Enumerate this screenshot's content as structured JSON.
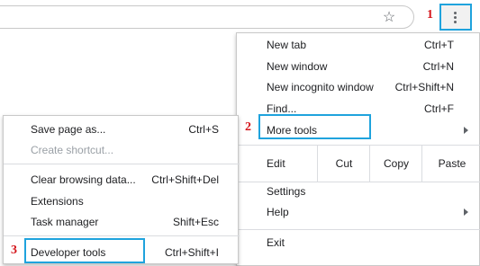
{
  "toolbar": {
    "star_icon": "star-outline-icon",
    "menu_icon": "three-dots-vertical-icon"
  },
  "steps": {
    "one": "1",
    "two": "2",
    "three": "3"
  },
  "colors": {
    "highlight": "#1fa3dd",
    "step_number": "#d4151b",
    "separator": "#dadce0"
  },
  "main_menu": {
    "new_tab": {
      "label": "New tab",
      "shortcut": "Ctrl+T"
    },
    "new_window": {
      "label": "New window",
      "shortcut": "Ctrl+N"
    },
    "new_incognito": {
      "label": "New incognito window",
      "shortcut": "Ctrl+Shift+N"
    },
    "find": {
      "label": "Find...",
      "shortcut": "Ctrl+F"
    },
    "more_tools": {
      "label": "More tools"
    },
    "edit_row": {
      "label": "Edit",
      "cut": "Cut",
      "copy": "Copy",
      "paste": "Paste"
    },
    "settings": {
      "label": "Settings"
    },
    "help": {
      "label": "Help"
    },
    "exit": {
      "label": "Exit"
    }
  },
  "sub_menu": {
    "save_page": {
      "label": "Save page as...",
      "shortcut": "Ctrl+S"
    },
    "create_shortcut": {
      "label": "Create shortcut..."
    },
    "clear_browsing": {
      "label": "Clear browsing data...",
      "shortcut": "Ctrl+Shift+Del"
    },
    "extensions": {
      "label": "Extensions"
    },
    "task_manager": {
      "label": "Task manager",
      "shortcut": "Shift+Esc"
    },
    "developer_tools": {
      "label": "Developer tools",
      "shortcut": "Ctrl+Shift+I"
    }
  }
}
